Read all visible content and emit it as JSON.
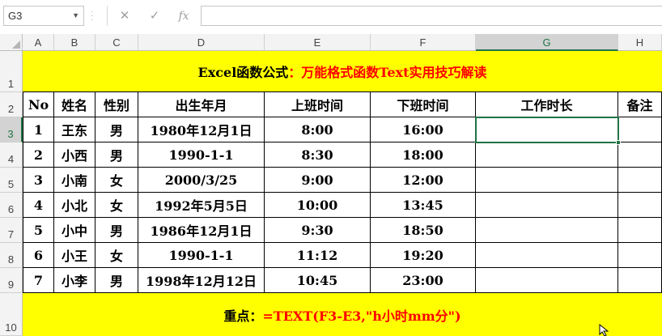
{
  "name_box": "G3",
  "formula_bar": {
    "cancel_icon": "✕",
    "enter_icon": "✓",
    "fx_label": "fx",
    "formula": ""
  },
  "columns": [
    "A",
    "B",
    "C",
    "D",
    "E",
    "F",
    "G",
    "H"
  ],
  "selected_column": "G",
  "rows": [
    "1",
    "2",
    "3",
    "4",
    "5",
    "6",
    "7",
    "8",
    "9",
    "10"
  ],
  "selected_row": "3",
  "title": {
    "part1": "Excel函数公式",
    "part2": "：万能格式函数Text实用技巧解读"
  },
  "headers": [
    "No",
    "姓名",
    "性别",
    "出生年月",
    "上班时间",
    "下班时间",
    "工作时长",
    "备注"
  ],
  "data_rows": [
    [
      "1",
      "王东",
      "男",
      "1980年12月1日",
      "8:00",
      "16:00",
      "",
      ""
    ],
    [
      "2",
      "小西",
      "男",
      "1990-1-1",
      "8:30",
      "18:00",
      "",
      ""
    ],
    [
      "3",
      "小南",
      "女",
      "2000/3/25",
      "9:00",
      "12:00",
      "",
      ""
    ],
    [
      "4",
      "小北",
      "女",
      "1992年5月5日",
      "10:00",
      "13:45",
      "",
      ""
    ],
    [
      "5",
      "小中",
      "男",
      "1986年12月1日",
      "9:30",
      "18:50",
      "",
      ""
    ],
    [
      "6",
      "小王",
      "女",
      "1990-1-1",
      "11:12",
      "19:20",
      "",
      ""
    ],
    [
      "7",
      "小李",
      "男",
      "1998年12月12日",
      "10:45",
      "23:00",
      "",
      ""
    ]
  ],
  "footer": {
    "label": "重点：",
    "formula": "=TEXT(F3-E3,\"h小时mm分\")"
  },
  "colors": {
    "banner_bg": "#ffff00",
    "accent_red": "#ff0000",
    "excel_green": "#217346"
  }
}
